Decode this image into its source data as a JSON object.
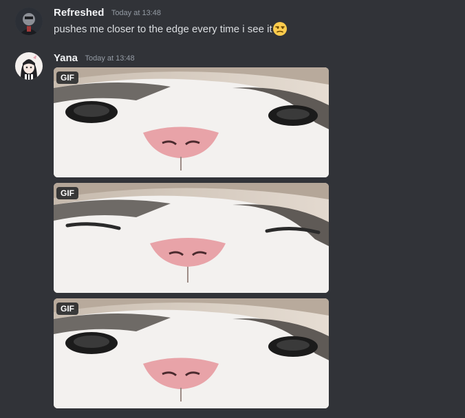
{
  "messages": [
    {
      "username": "Refreshed",
      "timestamp": "Today at 13:48",
      "text": "pushes me closer to the edge every time i see it",
      "emoji": "unamused-face-icon"
    },
    {
      "username": "Yana",
      "timestamp": "Today at 13:48",
      "attachments": [
        {
          "badge": "GIF",
          "expression": "eyes-open"
        },
        {
          "badge": "GIF",
          "expression": "eyes-squinting"
        },
        {
          "badge": "GIF",
          "expression": "eyes-open"
        }
      ]
    }
  ],
  "colors": {
    "background": "#313338",
    "username": "#f2f3f5",
    "timestamp": "#949ba4",
    "message_text": "#dbdee1"
  }
}
